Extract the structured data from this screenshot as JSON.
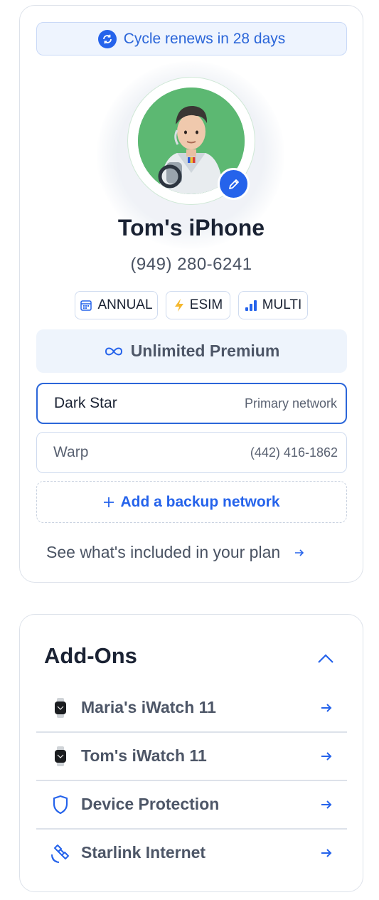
{
  "device": {
    "renew_text": "Cycle renews in 28 days",
    "name": "Tom's iPhone",
    "number": "(949) 280-6241",
    "chips": [
      {
        "label": "ANNUAL",
        "icon": "calendar-icon"
      },
      {
        "label": "ESIM",
        "icon": "lightning-icon"
      },
      {
        "label": "MULTI",
        "icon": "signal-bars-icon"
      }
    ],
    "plan": "Unlimited Premium",
    "networks": [
      {
        "name": "Dark Star",
        "meta": "Primary network"
      },
      {
        "name": "Warp",
        "meta": "(442) 416-1862"
      }
    ],
    "add_backup": "Add a backup network",
    "see_plan": "See what's included in your plan"
  },
  "addons": {
    "title": "Add-Ons",
    "items": [
      {
        "label": "Maria's iWatch 11",
        "icon": "watch-icon"
      },
      {
        "label": "Tom's iWatch 11",
        "icon": "watch-icon"
      },
      {
        "label": "Device Protection",
        "icon": "shield-icon"
      },
      {
        "label": "Starlink Internet",
        "icon": "satellite-icon"
      }
    ]
  },
  "colors": {
    "accent": "#2563eb",
    "avatar_bg": "#5cb872",
    "border": "#dde2ea"
  }
}
